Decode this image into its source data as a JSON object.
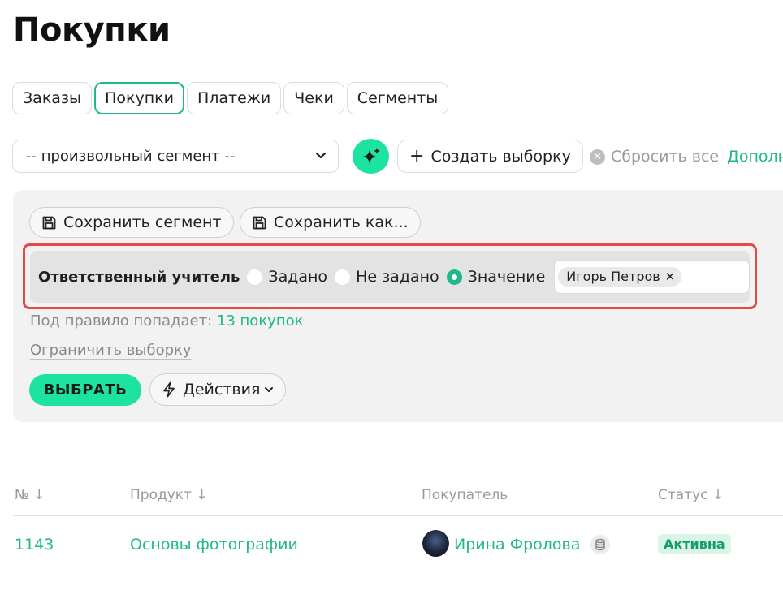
{
  "page": {
    "title": "Покупки"
  },
  "tabs": [
    {
      "label": "Заказы",
      "active": false
    },
    {
      "label": "Покупки",
      "active": true
    },
    {
      "label": "Платежи",
      "active": false
    },
    {
      "label": "Чеки",
      "active": false
    },
    {
      "label": "Сегменты",
      "active": false
    }
  ],
  "toolbar": {
    "segment_select_value": "-- произвольный сегмент --",
    "ai_icon": "sparkles-icon",
    "create_label": "Создать выборку",
    "reset_label": "Сбросить все",
    "more_label": "Дополн"
  },
  "filter_panel": {
    "save_segment_label": "Сохранить сегмент",
    "save_as_label": "Сохранить как...",
    "rule": {
      "label": "Ответственный учитель",
      "options": [
        {
          "label": "Задано",
          "checked": false
        },
        {
          "label": "Не задано",
          "checked": false
        },
        {
          "label": "Значение",
          "checked": true
        }
      ],
      "value_chip": "Игорь Петров"
    },
    "match_prefix": "Под правило попадает:",
    "match_count": "13 покупок",
    "limit_label": "Ограничить выборку",
    "select_label": "ВЫБРАТЬ",
    "actions_label": "Действия"
  },
  "table": {
    "columns": [
      "№ ↓",
      "Продукт ↓",
      "Покупатель",
      "Статус ↓"
    ],
    "rows": [
      {
        "number": "1143",
        "product": "Основы фотографии",
        "buyer": "Ирина Фролова",
        "status": "Активна"
      }
    ]
  },
  "colors": {
    "accent": "#1de3a0",
    "link_green": "#1fb88a",
    "highlight_red": "#e24a4a",
    "panel_gray": "#f2f2f2"
  }
}
